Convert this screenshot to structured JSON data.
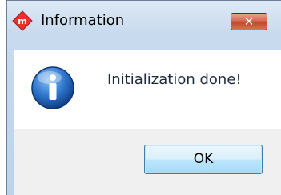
{
  "window": {
    "title": "Information",
    "close_label": "✕"
  },
  "dialog": {
    "message": "Initialization done!",
    "ok_label": "OK"
  },
  "icons": {
    "app": "app-logo-icon",
    "info": "info-icon",
    "close": "close-icon"
  },
  "colors": {
    "close_button": "#c4462a",
    "info_blue": "#1f5fae",
    "ok_button_border": "#3c7fb1"
  }
}
